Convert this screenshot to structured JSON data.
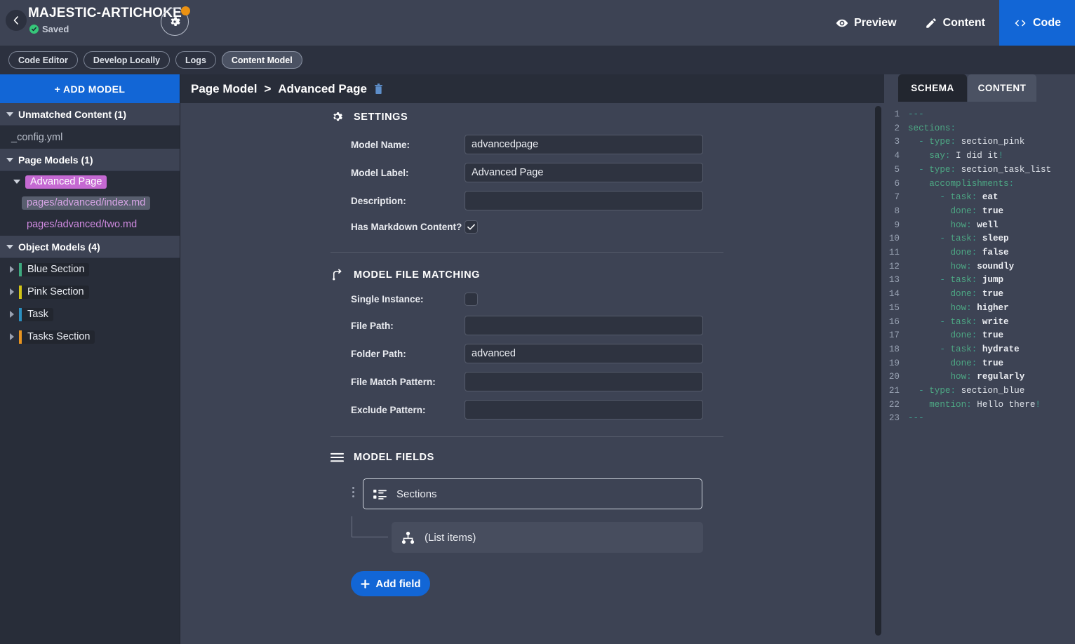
{
  "header": {
    "back_icon": "chevron-left-icon",
    "site_title": "MAJESTIC-ARTICHOKE",
    "status": "Saved",
    "status_icon": "check-circle-icon",
    "gear_icon": "gear-icon",
    "gear_badge_color": "#eb9112",
    "tabs": [
      {
        "label": "Preview",
        "icon": "eye-icon",
        "active": false
      },
      {
        "label": "Content",
        "icon": "pencil-icon",
        "active": false
      },
      {
        "label": "Code",
        "icon": "code-brackets-icon",
        "active": true
      }
    ],
    "accent_color": "#1266d6"
  },
  "toolbar": {
    "pills": [
      {
        "label": "Code Editor",
        "active": false
      },
      {
        "label": "Develop Locally",
        "active": false
      },
      {
        "label": "Logs",
        "active": false
      },
      {
        "label": "Content Model",
        "active": true
      }
    ]
  },
  "sidebar": {
    "add_model_label": "+ ADD MODEL",
    "groups": [
      {
        "label": "Unmatched Content (1)",
        "expanded": true,
        "files": [
          "_config.yml"
        ]
      },
      {
        "label": "Page Models (1)",
        "expanded": true,
        "page_model": {
          "label": "Advanced Page",
          "expanded": true,
          "files": [
            {
              "path": "pages/advanced/index.md",
              "selected": true
            },
            {
              "path": "pages/advanced/two.md",
              "selected": false
            }
          ]
        }
      },
      {
        "label": "Object Models (4)",
        "expanded": true,
        "objects": [
          {
            "label": "Blue Section",
            "color": "#3ea97f"
          },
          {
            "label": "Pink Section",
            "color": "#d2c417"
          },
          {
            "label": "Task",
            "color": "#2b8fc0"
          },
          {
            "label": "Tasks Section",
            "color": "#e89420"
          }
        ]
      }
    ]
  },
  "main": {
    "breadcrumb_root": "Page Model",
    "breadcrumb_sep": ">",
    "breadcrumb_current": "Advanced Page",
    "delete_icon": "trash-icon",
    "settings": {
      "icon": "gear-icon",
      "title": "SETTINGS",
      "fields": [
        {
          "label": "Model Name:",
          "value": "advancedpage",
          "type": "text"
        },
        {
          "label": "Model Label:",
          "value": "Advanced Page",
          "type": "text"
        },
        {
          "label": "Description:",
          "value": "",
          "type": "text"
        },
        {
          "label": "Has Markdown Content?",
          "value": "checked",
          "type": "checkbox"
        }
      ]
    },
    "file_matching": {
      "icon": "branch-icon",
      "title": "MODEL FILE MATCHING",
      "fields": [
        {
          "label": "Single Instance:",
          "value": "unchecked",
          "type": "checkbox"
        },
        {
          "label": "File Path:",
          "value": "",
          "type": "text"
        },
        {
          "label": "Folder Path:",
          "value": "advanced",
          "type": "text"
        },
        {
          "label": "File Match Pattern:",
          "value": "",
          "type": "text"
        },
        {
          "label": "Exclude Pattern:",
          "value": "",
          "type": "text"
        }
      ]
    },
    "model_fields": {
      "icon": "hamburger-icon",
      "title": "MODEL FIELDS",
      "items": [
        {
          "label": "Sections",
          "icon": "list-icon"
        },
        {
          "label": "(List items)",
          "icon": "hierarchy-icon"
        }
      ],
      "add_field_label": "Add field"
    }
  },
  "code": {
    "tabs": [
      {
        "label": "SCHEMA",
        "active": false
      },
      {
        "label": "CONTENT",
        "active": true
      }
    ],
    "lines": [
      {
        "n": "1",
        "segments": [
          {
            "t": "---",
            "c": "p"
          }
        ]
      },
      {
        "n": "2",
        "segments": [
          {
            "t": "sections",
            "c": "k"
          },
          {
            "t": ":",
            "c": "p"
          }
        ]
      },
      {
        "n": "3",
        "segments": [
          {
            "t": "  - ",
            "c": "p"
          },
          {
            "t": "type",
            "c": "k"
          },
          {
            "t": ": ",
            "c": "p"
          },
          {
            "t": "section_pink",
            "c": "s"
          }
        ]
      },
      {
        "n": "4",
        "segments": [
          {
            "t": "    ",
            "c": "s"
          },
          {
            "t": "say",
            "c": "k"
          },
          {
            "t": ": ",
            "c": "p"
          },
          {
            "t": "I did it",
            "c": "s"
          },
          {
            "t": "!",
            "c": "ex"
          }
        ]
      },
      {
        "n": "5",
        "segments": [
          {
            "t": "  - ",
            "c": "p"
          },
          {
            "t": "type",
            "c": "k"
          },
          {
            "t": ": ",
            "c": "p"
          },
          {
            "t": "section_task_list",
            "c": "s"
          }
        ]
      },
      {
        "n": "6",
        "segments": [
          {
            "t": "    ",
            "c": "s"
          },
          {
            "t": "accomplishments",
            "c": "k"
          },
          {
            "t": ":",
            "c": "p"
          }
        ]
      },
      {
        "n": "7",
        "segments": [
          {
            "t": "      - ",
            "c": "p"
          },
          {
            "t": "task",
            "c": "k"
          },
          {
            "t": ": ",
            "c": "p"
          },
          {
            "t": "eat",
            "c": "b"
          }
        ]
      },
      {
        "n": "8",
        "segments": [
          {
            "t": "        ",
            "c": "s"
          },
          {
            "t": "done",
            "c": "k"
          },
          {
            "t": ": ",
            "c": "p"
          },
          {
            "t": "true",
            "c": "b"
          }
        ]
      },
      {
        "n": "9",
        "segments": [
          {
            "t": "        ",
            "c": "s"
          },
          {
            "t": "how",
            "c": "k"
          },
          {
            "t": ": ",
            "c": "p"
          },
          {
            "t": "well",
            "c": "b"
          }
        ]
      },
      {
        "n": "10",
        "segments": [
          {
            "t": "      - ",
            "c": "p"
          },
          {
            "t": "task",
            "c": "k"
          },
          {
            "t": ": ",
            "c": "p"
          },
          {
            "t": "sleep",
            "c": "b"
          }
        ]
      },
      {
        "n": "11",
        "segments": [
          {
            "t": "        ",
            "c": "s"
          },
          {
            "t": "done",
            "c": "k"
          },
          {
            "t": ": ",
            "c": "p"
          },
          {
            "t": "false",
            "c": "b"
          }
        ]
      },
      {
        "n": "12",
        "segments": [
          {
            "t": "        ",
            "c": "s"
          },
          {
            "t": "how",
            "c": "k"
          },
          {
            "t": ": ",
            "c": "p"
          },
          {
            "t": "soundly",
            "c": "b"
          }
        ]
      },
      {
        "n": "13",
        "segments": [
          {
            "t": "      - ",
            "c": "p"
          },
          {
            "t": "task",
            "c": "k"
          },
          {
            "t": ": ",
            "c": "p"
          },
          {
            "t": "jump",
            "c": "b"
          }
        ]
      },
      {
        "n": "14",
        "segments": [
          {
            "t": "        ",
            "c": "s"
          },
          {
            "t": "done",
            "c": "k"
          },
          {
            "t": ": ",
            "c": "p"
          },
          {
            "t": "true",
            "c": "b"
          }
        ]
      },
      {
        "n": "15",
        "segments": [
          {
            "t": "        ",
            "c": "s"
          },
          {
            "t": "how",
            "c": "k"
          },
          {
            "t": ": ",
            "c": "p"
          },
          {
            "t": "higher",
            "c": "b"
          }
        ]
      },
      {
        "n": "16",
        "segments": [
          {
            "t": "      - ",
            "c": "p"
          },
          {
            "t": "task",
            "c": "k"
          },
          {
            "t": ": ",
            "c": "p"
          },
          {
            "t": "write",
            "c": "b"
          }
        ]
      },
      {
        "n": "17",
        "segments": [
          {
            "t": "        ",
            "c": "s"
          },
          {
            "t": "done",
            "c": "k"
          },
          {
            "t": ": ",
            "c": "p"
          },
          {
            "t": "true",
            "c": "b"
          }
        ]
      },
      {
        "n": "18",
        "segments": [
          {
            "t": "      - ",
            "c": "p"
          },
          {
            "t": "task",
            "c": "k"
          },
          {
            "t": ": ",
            "c": "p"
          },
          {
            "t": "hydrate",
            "c": "b"
          }
        ]
      },
      {
        "n": "19",
        "segments": [
          {
            "t": "        ",
            "c": "s"
          },
          {
            "t": "done",
            "c": "k"
          },
          {
            "t": ": ",
            "c": "p"
          },
          {
            "t": "true",
            "c": "b"
          }
        ]
      },
      {
        "n": "20",
        "segments": [
          {
            "t": "        ",
            "c": "s"
          },
          {
            "t": "how",
            "c": "k"
          },
          {
            "t": ": ",
            "c": "p"
          },
          {
            "t": "regularly",
            "c": "b"
          }
        ]
      },
      {
        "n": "21",
        "segments": [
          {
            "t": "  - ",
            "c": "p"
          },
          {
            "t": "type",
            "c": "k"
          },
          {
            "t": ": ",
            "c": "p"
          },
          {
            "t": "section_blue",
            "c": "s"
          }
        ]
      },
      {
        "n": "22",
        "segments": [
          {
            "t": "    ",
            "c": "s"
          },
          {
            "t": "mention",
            "c": "k"
          },
          {
            "t": ": ",
            "c": "p"
          },
          {
            "t": "Hello there",
            "c": "s"
          },
          {
            "t": "!",
            "c": "ex"
          }
        ]
      },
      {
        "n": "23",
        "segments": [
          {
            "t": "---",
            "c": "p"
          }
        ]
      }
    ]
  }
}
